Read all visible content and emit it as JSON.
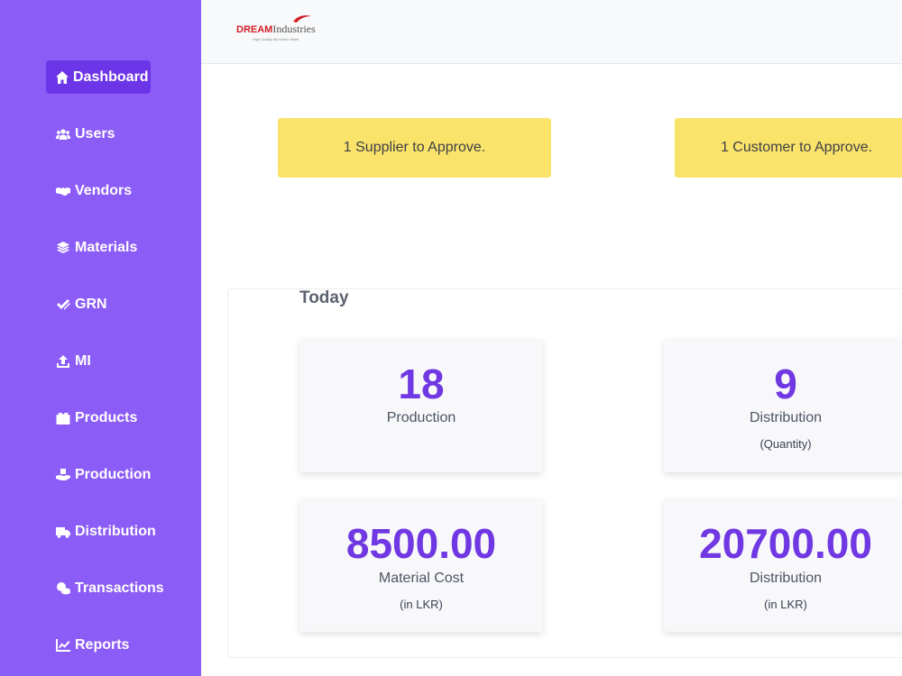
{
  "brand": {
    "name_part1": "DREAM",
    "name_part2": "Industries",
    "tagline": "High Quality Aluminum Ware",
    "accent_color": "#d21f26"
  },
  "sidebar": {
    "bg_color": "#8c5cf6",
    "items": [
      {
        "label": "Dashboard",
        "icon": "home-icon",
        "active": true
      },
      {
        "label": "Users",
        "icon": "users-icon"
      },
      {
        "label": "Vendors",
        "icon": "handshake-icon"
      },
      {
        "label": "Materials",
        "icon": "layers-icon"
      },
      {
        "label": "GRN",
        "icon": "check-double-icon"
      },
      {
        "label": "MI",
        "icon": "upload-icon"
      },
      {
        "label": "Products",
        "icon": "boxes-icon"
      },
      {
        "label": "Production",
        "icon": "hand-holding-icon"
      },
      {
        "label": "Distribution",
        "icon": "truck-icon"
      },
      {
        "label": "Transactions",
        "icon": "coins-icon"
      },
      {
        "label": "Reports",
        "icon": "chart-line-icon"
      }
    ]
  },
  "alerts": {
    "supplier": "1 Supplier to Approve.",
    "customer": "1 Customer to Approve.",
    "color": "#fae36a"
  },
  "today": {
    "title": "Today",
    "production": {
      "value": "18",
      "label": "Production"
    },
    "distribution_qty": {
      "value": "9",
      "label": "Distribution",
      "sub": "(Quantity)"
    },
    "material_cost": {
      "value": "8500.00",
      "label": "Material Cost",
      "sub": "(in LKR)"
    },
    "distribution_lkr": {
      "value": "20700.00",
      "label": "Distribution",
      "sub": "(in LKR)"
    },
    "value_color": "#7038e2"
  }
}
